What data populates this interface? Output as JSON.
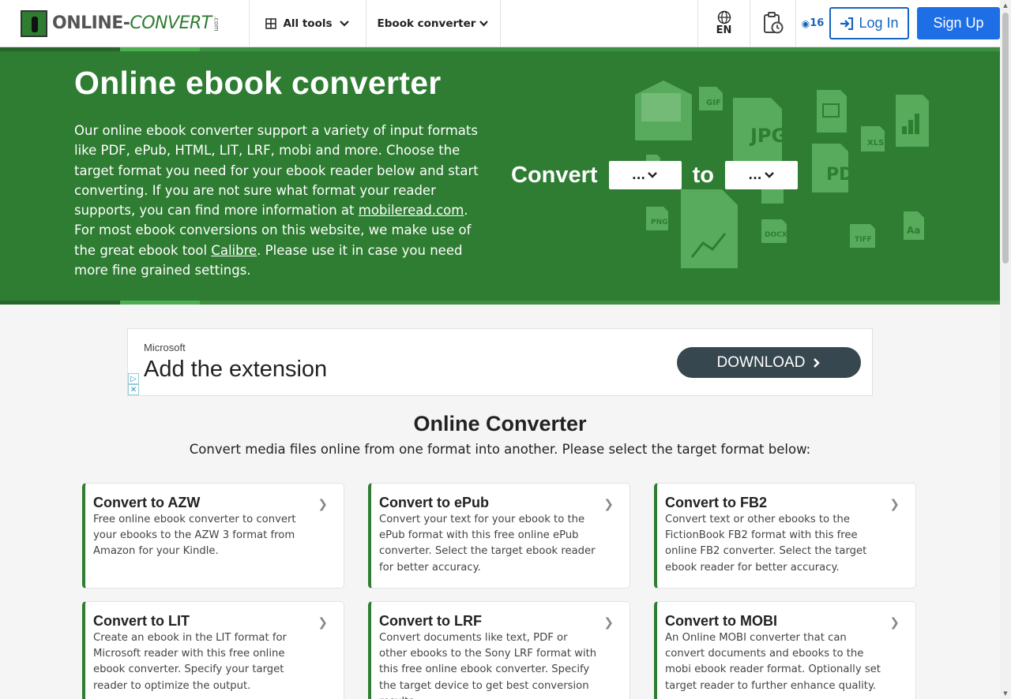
{
  "header": {
    "logo_text_a": "ONLINE-",
    "logo_text_b": "CONVERT",
    "logo_com": ".com",
    "all_tools": "All tools",
    "ebook_converter": "Ebook converter",
    "lang": "EN",
    "credits": "16",
    "login": "Log In",
    "signup": "Sign Up"
  },
  "hero": {
    "title": "Online ebook converter",
    "desc_1": "Our online ebook converter support a variety of input formats like PDF, ePub, HTML, LIT, LRF, mobi and more. Choose the target format you need for your ebook reader below and start converting. If you are not sure what format your reader supports, you can find more information at ",
    "link_mobileread": "mobileread.com",
    "desc_1_end": ".",
    "desc_2": "For most ebook conversions on this website, we make use of the great ebook tool ",
    "link_calibre": "Calibre",
    "desc_2_end": ". Please use it in case you need more fine grained settings.",
    "convert_label": "Convert",
    "to_label": "to",
    "from_value": "...",
    "to_value": "...",
    "file_badges": [
      "GIF",
      "JPG",
      "PDF",
      "XLS",
      "PNG",
      "DOCX",
      "TIFF",
      "Aa"
    ]
  },
  "ad": {
    "brand": "Microsoft",
    "title": "Add the extension",
    "button": "DOWNLOAD"
  },
  "section": {
    "title": "Online Converter",
    "subtitle": "Convert media files online from one format into another. Please select the target format below:"
  },
  "cards": [
    {
      "title": "Convert to AZW",
      "desc": "Free online ebook converter to convert your ebooks to the AZW 3 format from Amazon for your Kindle."
    },
    {
      "title": "Convert to ePub",
      "desc": "Convert your text for your ebook to the ePub format with this free online ePub converter. Select the target ebook reader for better accuracy."
    },
    {
      "title": "Convert to FB2",
      "desc": "Convert text or other ebooks to the FictionBook FB2 format with this free online FB2 converter. Select the target ebook reader for better accuracy."
    },
    {
      "title": "Convert to LIT",
      "desc": "Create an ebook in the LIT format for Microsoft reader with this free online ebook converter. Specify your target reader to optimize the output."
    },
    {
      "title": "Convert to LRF",
      "desc": "Convert documents like text, PDF or other ebooks to the Sony LRF format with this free online ebook converter. Specify the target device to get best conversion results."
    },
    {
      "title": "Convert to MOBI",
      "desc": "An Online MOBI converter that can convert documents and ebooks to the mobi ebook reader format. Optionally set target reader to further enhance quality."
    }
  ],
  "colors": {
    "brand_green": "#2e7d32",
    "primary_blue": "#1e6ee6",
    "ad_button": "#37474f"
  }
}
